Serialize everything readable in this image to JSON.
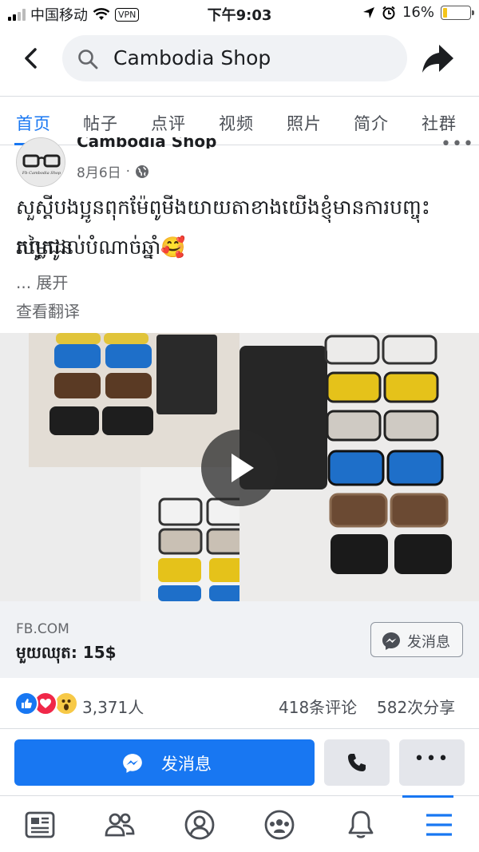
{
  "status_bar": {
    "carrier": "中国移动",
    "vpn": "VPN",
    "time": "下午9:03",
    "battery": "16%",
    "battery_level": 0.16
  },
  "nav": {
    "search_text": "Cambodia Shop"
  },
  "tabs": [
    {
      "label": "首页",
      "active": true
    },
    {
      "label": "帖子"
    },
    {
      "label": "点评"
    },
    {
      "label": "视频"
    },
    {
      "label": "照片"
    },
    {
      "label": "简介"
    },
    {
      "label": "社群"
    }
  ],
  "post": {
    "page_name": "Cambodia Shop",
    "avatar_text": "Fb Cambodia Shop",
    "date": "8月6日",
    "text_line1": "សួស្តីបងប្អូនពុកម៉ែពូមីងយាយតាខាងយើងខ្ញុំមានការបញ្ចុះតម្លៃជូន",
    "text_line2": "រហូតដល់បំណាច់ឆ្នាំ🥰",
    "expand": "... 展开",
    "translate": "查看翻译"
  },
  "link_card": {
    "domain": "FB.COM",
    "title": "មួយឈុត: 15$",
    "message_button": "发消息"
  },
  "stats": {
    "reactions": "3,371人",
    "comments": "418条评论",
    "shares": "582次分享"
  },
  "actions": {
    "message": "发消息"
  },
  "colors": {
    "accent": "#1877f2"
  }
}
